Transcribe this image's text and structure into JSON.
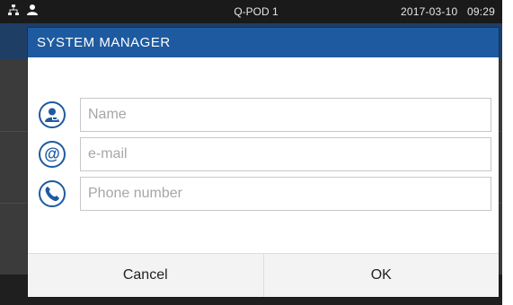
{
  "statusbar": {
    "title": "Q-POD 1",
    "date": "2017-03-10",
    "time": "09:29",
    "icons": [
      "network-icon",
      "user-icon"
    ]
  },
  "dialog": {
    "title": "SYSTEM MANAGER",
    "fields": [
      {
        "icon": "user-avatar-icon",
        "placeholder": "Name",
        "value": ""
      },
      {
        "icon": "at-sign-icon",
        "placeholder": "e-mail",
        "value": ""
      },
      {
        "icon": "phone-icon",
        "placeholder": "Phone number",
        "value": ""
      }
    ],
    "buttons": {
      "cancel": "Cancel",
      "ok": "OK"
    }
  },
  "colors": {
    "accent": "#1e5aa0",
    "statusbar_bg": "#1a1a1a",
    "screen_bg": "#2a2a2a"
  }
}
